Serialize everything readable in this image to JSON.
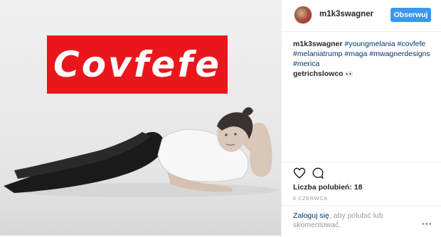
{
  "photo": {
    "banner_text": "Covfefe",
    "banner_color": "#e9171c"
  },
  "header": {
    "username": "m1k3swagner",
    "follow_label": "Obserwuj"
  },
  "caption": {
    "username": "m1k3swagner",
    "hashtags": [
      "#youngmelania",
      "#covfefe",
      "#melaniatrump",
      "#maga",
      "#mwagnerdesigns",
      "#merica"
    ]
  },
  "comment": {
    "username": "getrichslowco",
    "text": "👀"
  },
  "actions": {
    "like_icon": "heart-outline-icon",
    "comment_icon": "speech-bubble-icon",
    "likes_text": "Liczba polubień: 18",
    "date": "6 CZERWCA"
  },
  "login": {
    "link": "Zaloguj się",
    "text": ", aby polubić lub skomentować.",
    "more": "•••"
  },
  "colors": {
    "accent": "#3897f0",
    "link": "#003569",
    "muted": "#999999"
  }
}
